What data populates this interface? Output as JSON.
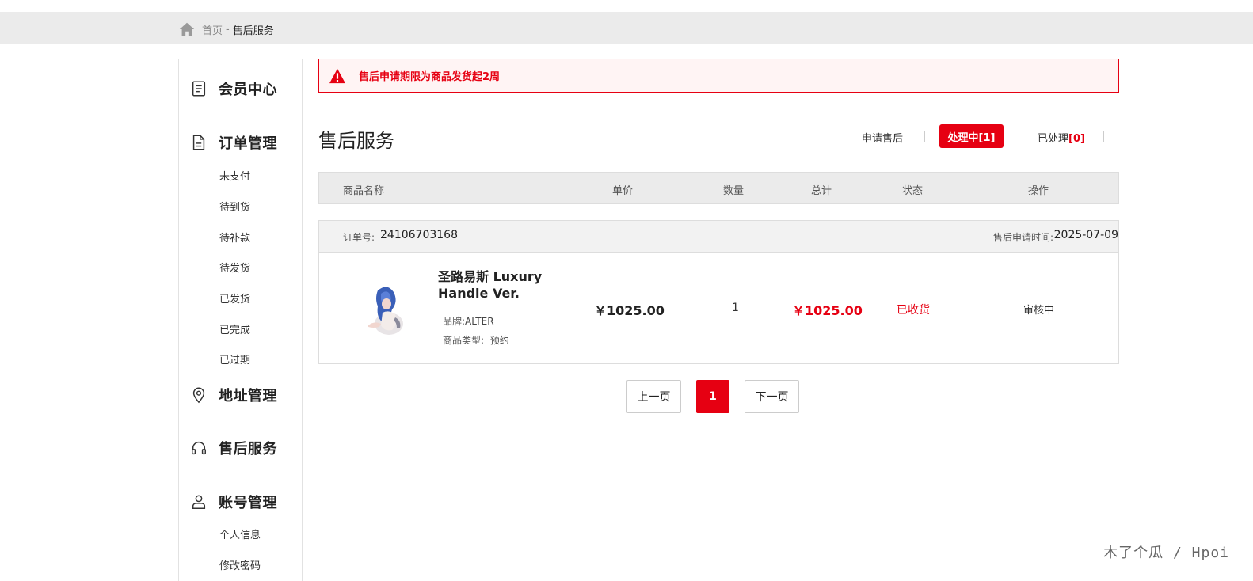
{
  "breadcrumb": {
    "home": "首页",
    "separator": "-",
    "current": "售后服务"
  },
  "sidebar": {
    "member_center": "会员中心",
    "order_mgmt": "订单管理",
    "order_items": [
      "未支付",
      "待到货",
      "待补款",
      "待发货",
      "已发货",
      "已完成",
      "已过期"
    ],
    "address_mgmt": "地址管理",
    "after_sales": "售后服务",
    "account_mgmt": "账号管理",
    "account_items": [
      "个人信息",
      "修改密码"
    ]
  },
  "notice": {
    "text": "售后申请期限为商品发货起2周",
    "color": "#e60012"
  },
  "page_title": "售后服务",
  "tabs": {
    "apply": "申请售后",
    "processing": "处理中[1]",
    "done_label": "已处理",
    "done_count": "[0]"
  },
  "table_header": [
    "商品名称",
    "单价",
    "数量",
    "总计",
    "状态",
    "操作"
  ],
  "order": {
    "no_label": "订单号:",
    "no": "24106703168",
    "time_label": "售后申请时间:",
    "time": "2025-07-09",
    "product": {
      "name": "圣路易斯 Luxury Handle Ver.",
      "brand_label": "品牌:",
      "brand": "ALTER",
      "type_label": "商品类型:",
      "type": "预约"
    },
    "unit_price": "￥1025.00",
    "quantity": "1",
    "total": "￥1025.00",
    "status": "已收货",
    "action": "审核中"
  },
  "pagination": {
    "prev": "上一页",
    "current": "1",
    "next": "下一页"
  },
  "watermark": "木了个瓜 / Hpoi",
  "accent_color": "#e60012"
}
